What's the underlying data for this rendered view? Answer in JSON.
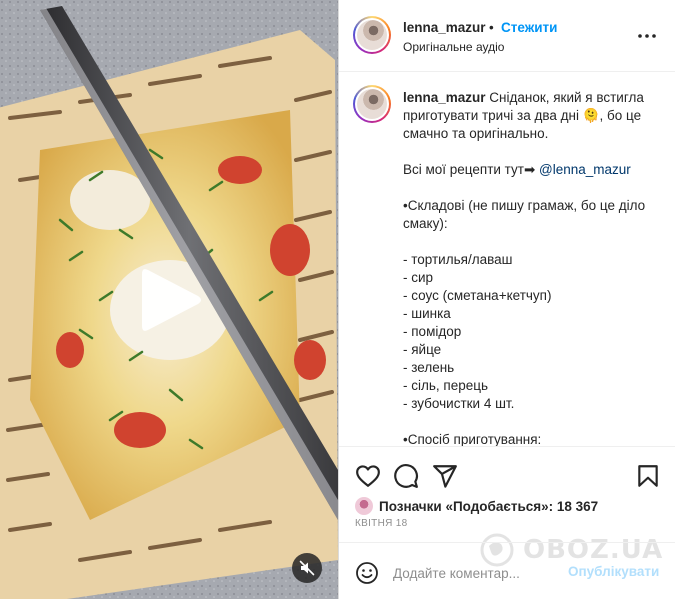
{
  "header": {
    "username": "lenna_mazur",
    "separator": "•",
    "follow_label": "Стежити",
    "audio_label": "Оригінальне аудіо",
    "more_icon": "more-horizontal-icon"
  },
  "caption": {
    "username": "lenna_mazur",
    "text_part1": " Сніданок, який я встигла приготувати тричі за два дні 🫠, бо це смачно та оригінально.\n\nВсі мої рецепти тут➡ ",
    "mention": "@lenna_mazur",
    "text_part2": "\n\n•Складові (не пишу грамаж, бо це діло смаку):\n\n- тортилья/лаваш\n- сир\n- соус (сметана+кетчуп)\n- шинка\n- помідор\n- яйце\n- зелень\n- сіль, перець\n- зубочистки 4 шт.\n\n•Спосіб приготування:"
  },
  "actions": {
    "like_icon": "heart-icon",
    "comment_icon": "comment-icon",
    "share_icon": "send-icon",
    "save_icon": "bookmark-icon",
    "likes_text": "Позначки «Подобається»: 18 367",
    "date": "КВІТНЯ 18"
  },
  "comment": {
    "placeholder": "Додайте коментар...",
    "publish_label": "Опублікувати",
    "emoji_icon": "emoji-icon"
  },
  "media": {
    "play_icon": "play-icon",
    "mute_icon": "sound-off-icon"
  },
  "watermark": {
    "text": "OBOZ.UA"
  }
}
